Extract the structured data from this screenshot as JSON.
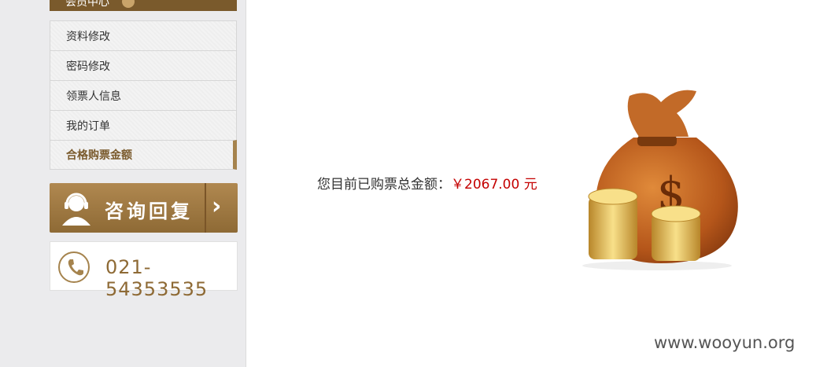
{
  "sidebar": {
    "member_center_label": "会员中心",
    "menu_items": [
      {
        "label": "资料修改"
      },
      {
        "label": "密码修改"
      },
      {
        "label": "领票人信息"
      },
      {
        "label": "我的订单"
      },
      {
        "label": "合格购票金额"
      }
    ],
    "consult_label": "咨询回复",
    "phone_number": "021-54353535"
  },
  "main": {
    "total_label": "您目前已购票总金额：",
    "total_amount": "￥2067.00",
    "total_unit": "元"
  },
  "watermark": "www.wooyun.org",
  "colors": {
    "brand_brown": "#8e6a35",
    "amount_red": "#c40000"
  },
  "icons": [
    "help-icon",
    "headset-person-icon",
    "chevron-right-icon",
    "phone-icon",
    "money-bag-icon",
    "coin-stack-icon"
  ]
}
